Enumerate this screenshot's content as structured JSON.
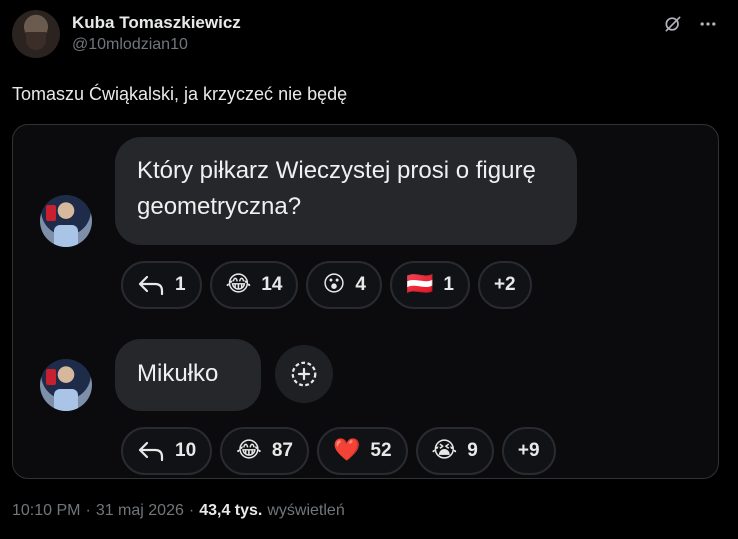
{
  "author": {
    "name": "Kuba Tomaszkiewicz",
    "handle": "@10mlodzian10"
  },
  "tweet": {
    "text": "Tomaszu Ćwiąkalski, ja krzyczeć nie będę"
  },
  "chat": {
    "message1": {
      "text": "Który piłkarz Wieczystej prosi o figurę geometryczna?",
      "reactions": [
        {
          "icon": "reply-icon",
          "count": "1"
        },
        {
          "icon": "😂",
          "count": "14"
        },
        {
          "icon": "😮",
          "count": "4"
        },
        {
          "icon": "🇦🇹",
          "count": "1"
        },
        {
          "icon": "",
          "count": "+2"
        }
      ]
    },
    "message2": {
      "text": "Mikułko",
      "reactions": [
        {
          "icon": "reply-icon",
          "count": "10"
        },
        {
          "icon": "😂",
          "count": "87"
        },
        {
          "icon": "❤️",
          "count": "52"
        },
        {
          "icon": "😭",
          "count": "9"
        },
        {
          "icon": "",
          "count": "+9"
        }
      ]
    }
  },
  "footer": {
    "time": "10:10 PM",
    "date": "31 maj 2026",
    "views_count": "43,4 tys.",
    "views_label": "wyświetleń",
    "separator": "·"
  },
  "colors": {
    "background": "#000000",
    "bubble": "#26272b",
    "muted": "#71767b"
  }
}
